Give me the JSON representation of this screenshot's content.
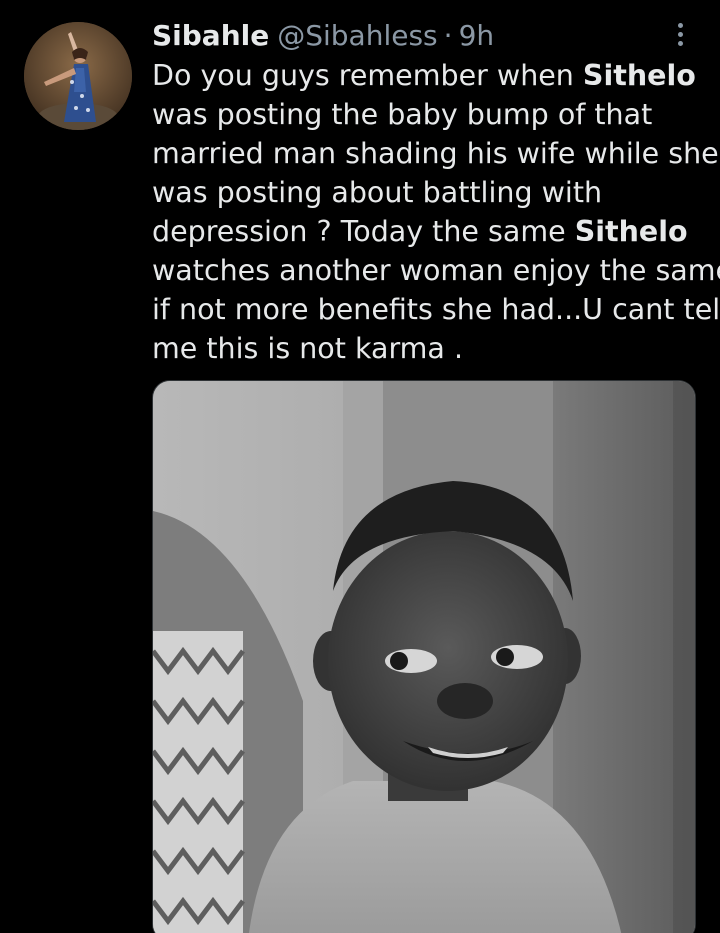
{
  "tweet": {
    "author": {
      "display_name": "Sibahle",
      "handle": "@Sibahless",
      "separator": "·",
      "time": "9h",
      "avatar_icon": "profile-photo"
    },
    "more_icon": "more-vertical-icon",
    "text_lines": [
      [
        "Do you guys remember when ",
        "Sithelo",
        ""
      ],
      [
        "was posting the baby bump of that",
        "",
        ""
      ],
      [
        "married man shading his wife while she",
        "",
        ""
      ],
      [
        "was posting about battling with",
        "",
        ""
      ],
      [
        "depression ? Today the same ",
        "Sithelo",
        ""
      ],
      [
        "watches another woman enjoy the same",
        "",
        ""
      ],
      [
        "if not more benefits she had...U cant tell",
        "",
        ""
      ],
      [
        "me this is not karma  .",
        "",
        ""
      ]
    ],
    "media": {
      "type": "photo",
      "description_icon": "grayscale-meme-photo"
    }
  },
  "colors": {
    "background": "#000000",
    "primary_text": "#e7e9ea",
    "secondary_text": "#8b98a5"
  }
}
